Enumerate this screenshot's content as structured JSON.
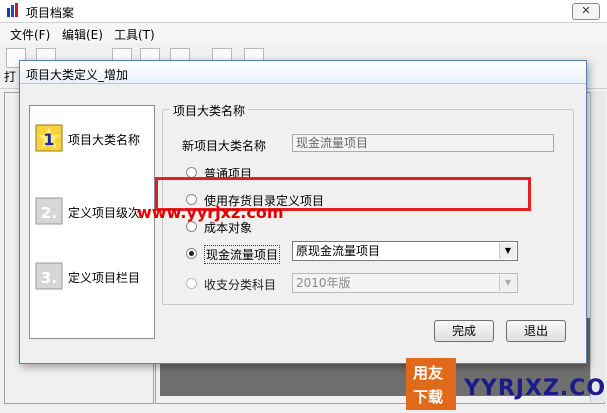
{
  "outer_window": {
    "title": "项目档案",
    "close_glyph": "✕",
    "menu": [
      "文件(F)",
      "编辑(E)",
      "工具(T)"
    ],
    "print_label": "打"
  },
  "dialog": {
    "title": "项目大类定义_增加",
    "steps": [
      {
        "number": "1",
        "label": "项目大类名称",
        "active": true
      },
      {
        "number": "2.",
        "label": "定义项目级次",
        "active": false
      },
      {
        "number": "3.",
        "label": "定义项目栏目",
        "active": false
      }
    ],
    "group_legend": "项目大类名称",
    "new_name_label": "新项目大类名称",
    "new_name_value": "现金流量项目",
    "options": [
      {
        "label": "普通项目",
        "selected": false,
        "disabled": false
      },
      {
        "label": "使用存货目录定义项目",
        "selected": false,
        "disabled": false
      },
      {
        "label": "成本对象",
        "selected": false,
        "disabled": false
      },
      {
        "label": "现金流量项目",
        "selected": true,
        "disabled": false,
        "select_value": "原现金流量项目"
      },
      {
        "label": "收支分类科目",
        "selected": false,
        "disabled": true,
        "select_value": "2010年版"
      }
    ],
    "finish_label": "完成",
    "exit_label": "退出"
  },
  "watermarks": {
    "site": "www.yyrjxz.com",
    "brand_top": "用友",
    "brand_bottom": "下载",
    "brand_text": "YYRJXZ.COM"
  },
  "colors": {
    "highlight": "#e02020",
    "brand_orange": "#e06a1a",
    "brand_blue": "#1b1b8a"
  }
}
